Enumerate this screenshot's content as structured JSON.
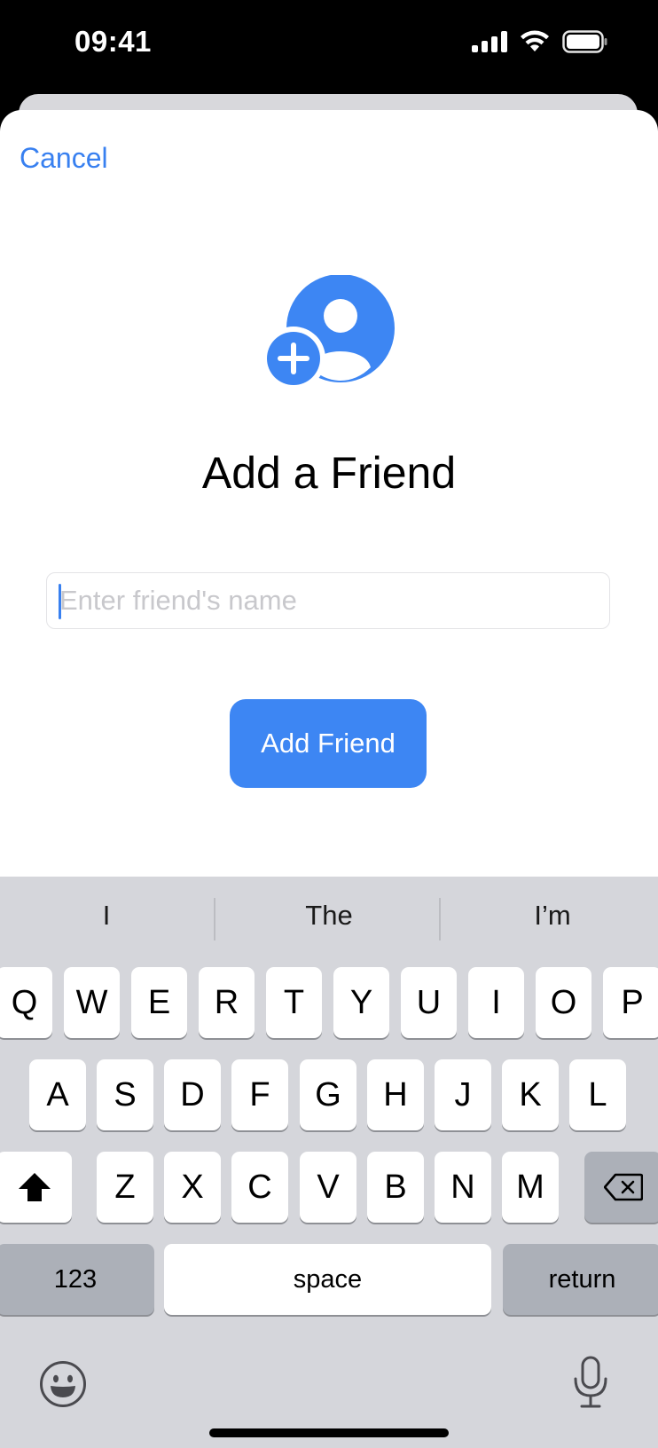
{
  "status_bar": {
    "time": "09:41",
    "icons": [
      "cellular-signal-icon",
      "wifi-icon",
      "battery-icon"
    ]
  },
  "sheet": {
    "cancel_label": "Cancel",
    "icon": "add-person-icon",
    "title": "Add a Friend",
    "name_input": {
      "value": "",
      "placeholder": "Enter friend's name"
    },
    "submit_label": "Add Friend"
  },
  "keyboard": {
    "suggestions": [
      "I",
      "The",
      "I’m"
    ],
    "row1": [
      "Q",
      "W",
      "E",
      "R",
      "T",
      "Y",
      "U",
      "I",
      "O",
      "P"
    ],
    "row2": [
      "A",
      "S",
      "D",
      "F",
      "G",
      "H",
      "J",
      "K",
      "L"
    ],
    "row3": [
      "Z",
      "X",
      "C",
      "V",
      "B",
      "N",
      "M"
    ],
    "numbers_label": "123",
    "space_label": "space",
    "return_label": "return",
    "icons": [
      "shift-icon",
      "backspace-icon",
      "emoji-icon",
      "microphone-icon"
    ]
  },
  "colors": {
    "accent": "#3d86f3",
    "keyboard_bg": "#d5d6db",
    "key_dark": "#acb0b8"
  }
}
